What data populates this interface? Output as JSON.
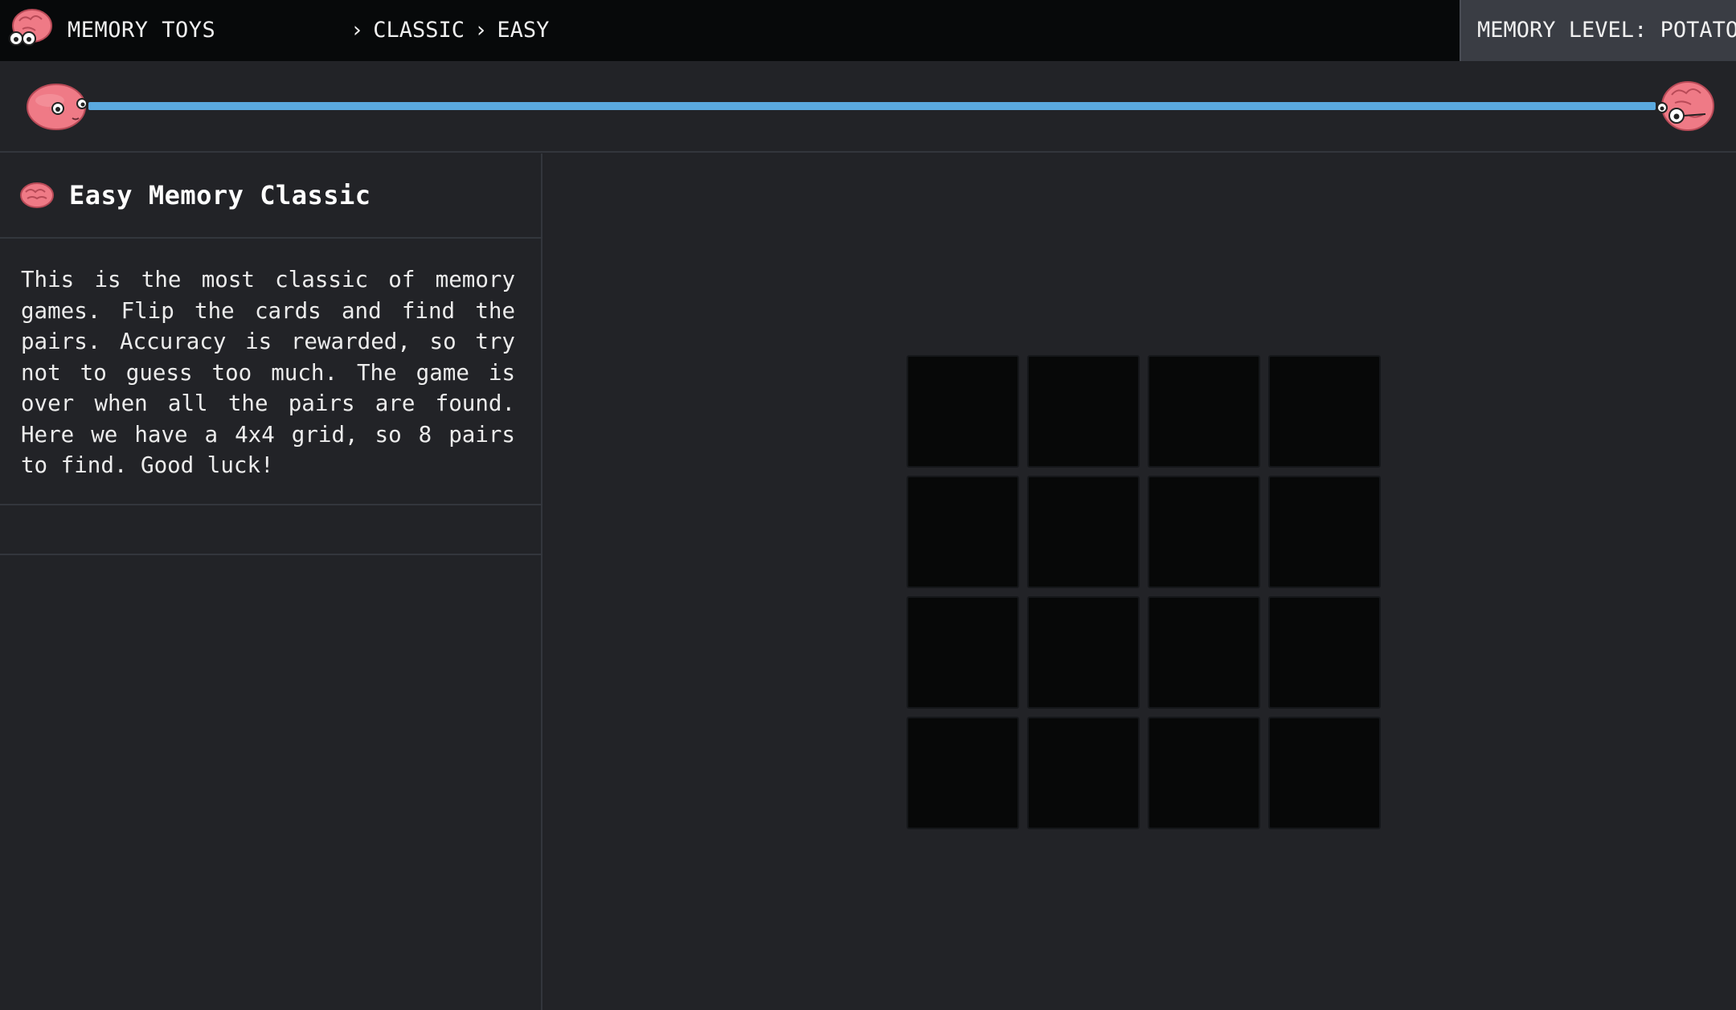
{
  "header": {
    "brand": "MEMORY TOYS",
    "breadcrumb": [
      {
        "sep": "›",
        "label": "CLASSIC"
      },
      {
        "sep": "›",
        "label": "EASY"
      }
    ],
    "level_label": "MEMORY LEVEL:",
    "level_value": "POTATO",
    "logo_icon": "brain-with-glasses-icon"
  },
  "progress": {
    "fraction": 1.0,
    "start_icon": "happy-brain-icon",
    "end_icon": "brain-with-glasses-icon",
    "fill_color": "#5aa9df"
  },
  "sidebar": {
    "title_icon": "brain-icon",
    "title": "Easy Memory Classic",
    "description": "This is the most classic of memory games. Flip the cards and find the pairs. Accuracy is rewarded, so try not to guess too much. The game is over when all the pairs are found. Here we have a 4x4 grid, so 8 pairs to find. Good luck!"
  },
  "board": {
    "rows": 4,
    "cols": 4,
    "cards_face_down": 16,
    "card_color": "#070808"
  },
  "colors": {
    "background": "#222327",
    "topbar": "#07090a",
    "badge": "#3a3d44",
    "brain_pink": "#ef7a86"
  }
}
